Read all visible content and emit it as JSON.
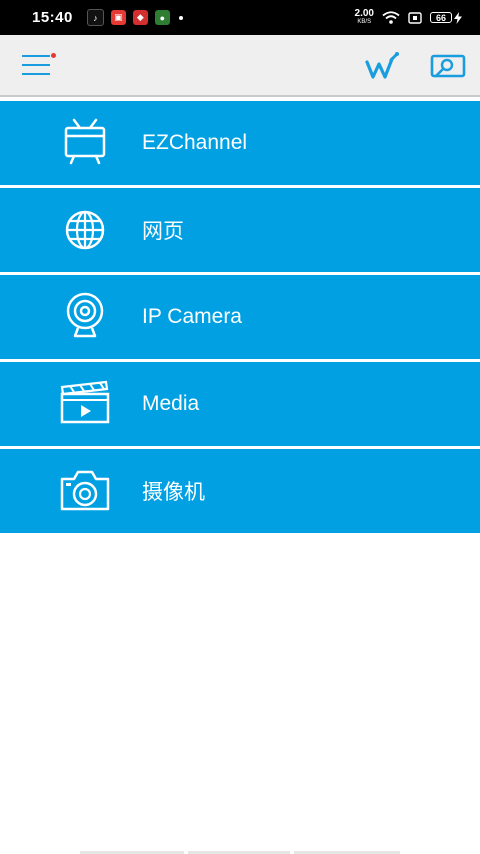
{
  "status_bar": {
    "time": "15:40",
    "net_speed_value": "2.00",
    "net_speed_unit": "KB/S",
    "battery_level": "66"
  },
  "toolbar": {
    "menu_icon": "hamburger-menu-icon",
    "right_icons": [
      "wifi-display-icon",
      "screen-cast-icon"
    ],
    "accent_color": "#1a9ddf",
    "notification_dot_color": "#e53935"
  },
  "menu": {
    "background_color": "#00a0e2",
    "items": [
      {
        "label": "EZChannel",
        "icon": "tv-icon"
      },
      {
        "label": "网页",
        "icon": "globe-icon"
      },
      {
        "label": "IP Camera",
        "icon": "webcam-icon"
      },
      {
        "label": "Media",
        "icon": "clapperboard-icon"
      },
      {
        "label": "摄像机",
        "icon": "camera-icon"
      }
    ]
  }
}
